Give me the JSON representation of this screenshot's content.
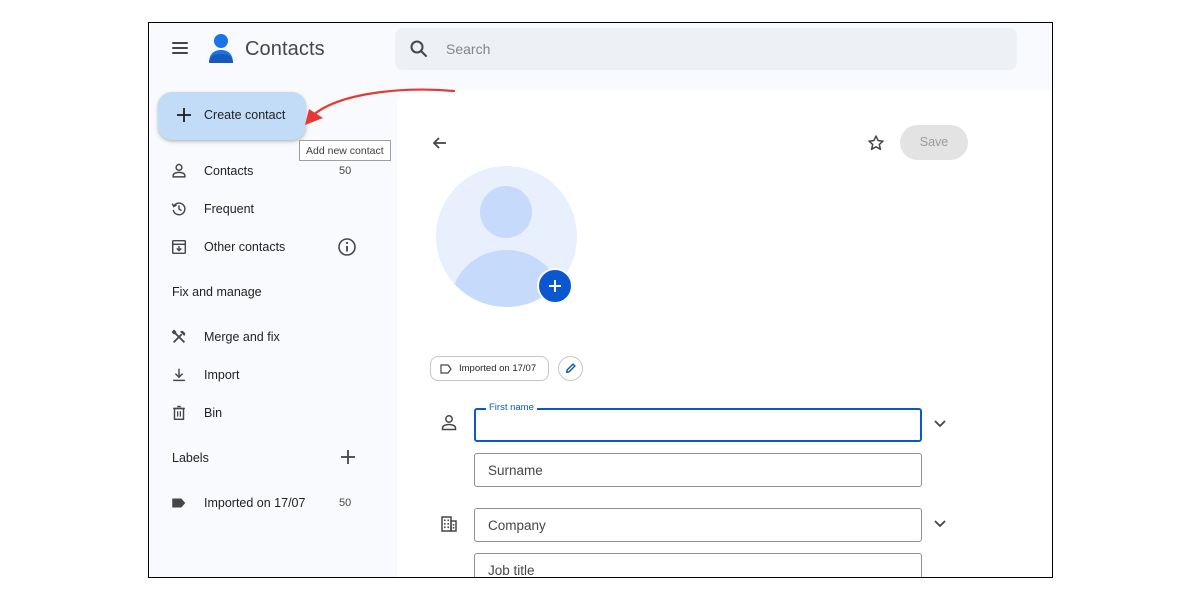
{
  "app": {
    "title": "Contacts"
  },
  "search": {
    "placeholder": "Search"
  },
  "create": {
    "label": "Create contact",
    "tooltip": "Add new contact"
  },
  "sidebar": {
    "items": [
      {
        "label": "Contacts",
        "count": "50",
        "icon": "person-icon"
      },
      {
        "label": "Frequent",
        "count": "",
        "icon": "history-icon"
      },
      {
        "label": "Other contacts",
        "count": "",
        "icon": "archive-icon"
      }
    ],
    "fix_title": "Fix and manage",
    "fix_items": [
      {
        "label": "Merge and fix",
        "icon": "tools-icon"
      },
      {
        "label": "Import",
        "icon": "download-icon"
      },
      {
        "label": "Bin",
        "icon": "trash-icon"
      }
    ],
    "labels_title": "Labels",
    "labels": [
      {
        "label": "Imported on 17/07",
        "count": "50",
        "icon": "label-icon"
      }
    ]
  },
  "editor": {
    "save_label": "Save",
    "chip_label": "Imported on 17/07",
    "fields": {
      "first_name": "First name",
      "surname": "Surname",
      "company": "Company",
      "job_title": "Job title"
    }
  },
  "colors": {
    "accent": "#0b57d0",
    "create_bg": "#c2dcf7",
    "annotation_arrow": "#e53935"
  }
}
